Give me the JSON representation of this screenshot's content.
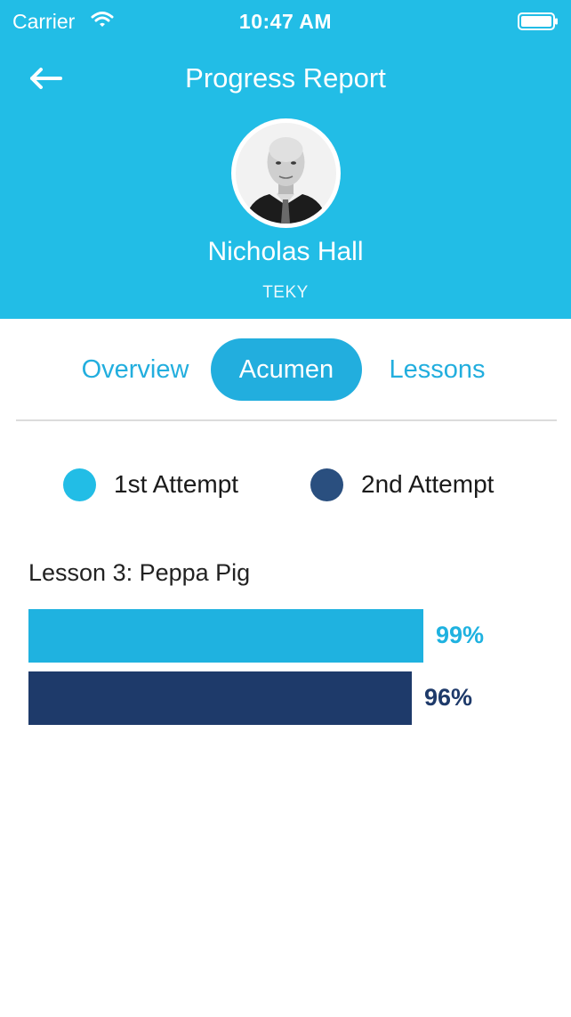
{
  "status_bar": {
    "carrier": "Carrier",
    "time": "10:47 AM"
  },
  "header": {
    "title": "Progress Report",
    "name": "Nicholas Hall",
    "org": "TEKY"
  },
  "tabs": [
    {
      "label": "Overview",
      "active": false
    },
    {
      "label": "Acumen",
      "active": true
    },
    {
      "label": "Lessons",
      "active": false
    }
  ],
  "legend": [
    {
      "label": "1st Attempt",
      "color": "#22bde6"
    },
    {
      "label": "2nd Attempt",
      "color": "#2a4f7f"
    }
  ],
  "chart_data": {
    "type": "bar",
    "orientation": "horizontal",
    "title": "Lesson 3: Peppa Pig",
    "xlim": [
      0,
      140
    ],
    "series": [
      {
        "name": "1st Attempt",
        "value": 99,
        "label": "99%",
        "color": "#1fb2e0"
      },
      {
        "name": "2nd Attempt",
        "value": 96,
        "label": "96%",
        "color": "#1e3a6a"
      }
    ]
  },
  "colors": {
    "header_bg": "#22bde6",
    "accent": "#22aede"
  },
  "icons": {
    "back": "arrow-left-icon",
    "wifi": "wifi-icon",
    "battery": "battery-icon"
  }
}
